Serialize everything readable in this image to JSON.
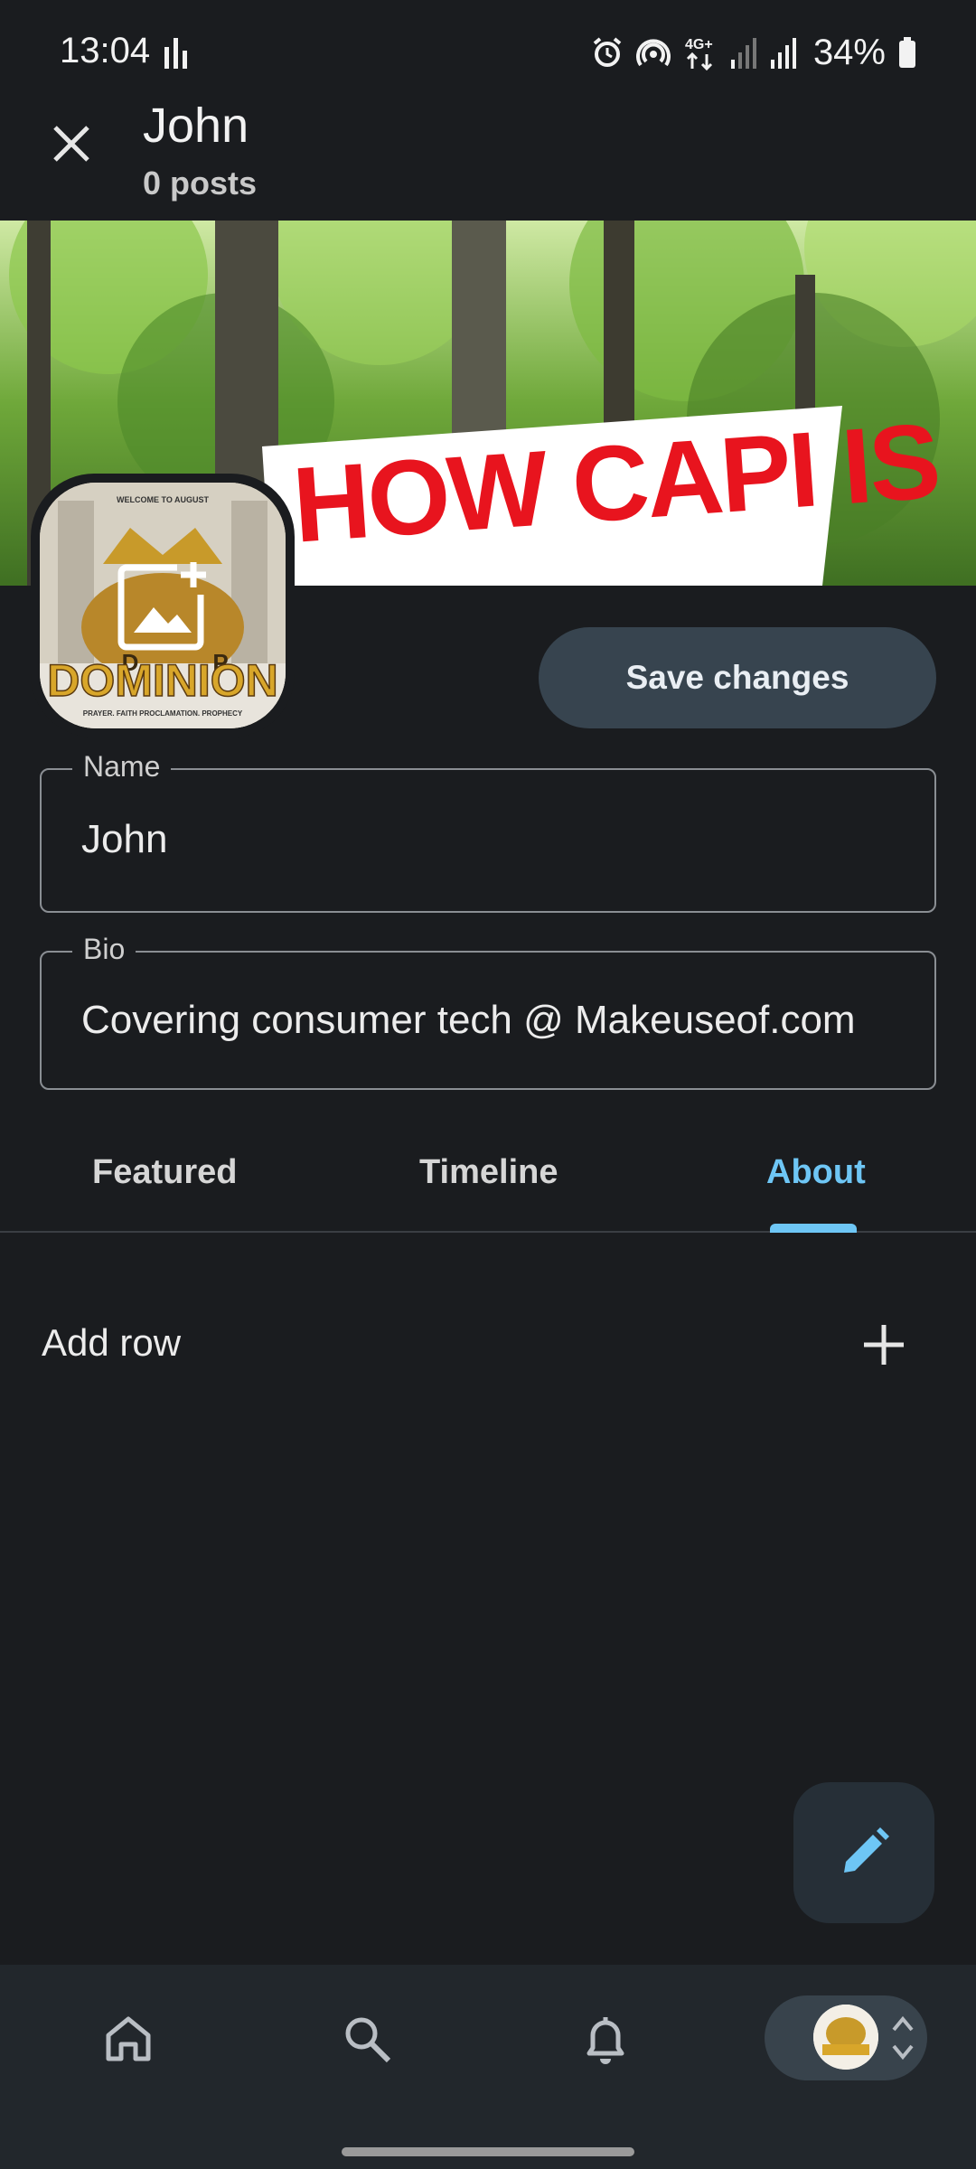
{
  "status_bar": {
    "time": "13:04",
    "battery": "34%",
    "network": "4G+",
    "icons": [
      "equalizer-icon",
      "alarm-icon",
      "hotspot-icon",
      "network-4g-icon",
      "signal-icon",
      "signal-icon",
      "battery-icon"
    ]
  },
  "header": {
    "title": "John",
    "subtitle": "0 posts",
    "close_icon": "close-icon"
  },
  "banner": {
    "text": "HOW CAPI IS"
  },
  "avatar": {
    "edit_icon": "add-photo-icon",
    "image_lines": [
      "WELCOME TO AUGUST",
      "D",
      "P",
      "DOMINION",
      "PRAYER. FAITH PROCLAMATION. PROPHECY"
    ]
  },
  "actions": {
    "save_label": "Save changes"
  },
  "form": {
    "name_label": "Name",
    "name_value": "John",
    "bio_label": "Bio",
    "bio_value": "Covering consumer tech @ Makeuseof.com"
  },
  "tabs": [
    {
      "label": "Featured",
      "selected": false
    },
    {
      "label": "Timeline",
      "selected": false
    },
    {
      "label": "About",
      "selected": true
    }
  ],
  "about": {
    "add_row_label": "Add row"
  },
  "fab": {
    "icon": "pencil-icon"
  },
  "bottom_nav": {
    "items": [
      "home-icon",
      "search-icon",
      "notifications-icon",
      "account-switcher"
    ]
  },
  "colors": {
    "background": "#1a1c1f",
    "accent": "#6ec6f5",
    "button": "#37444f"
  }
}
